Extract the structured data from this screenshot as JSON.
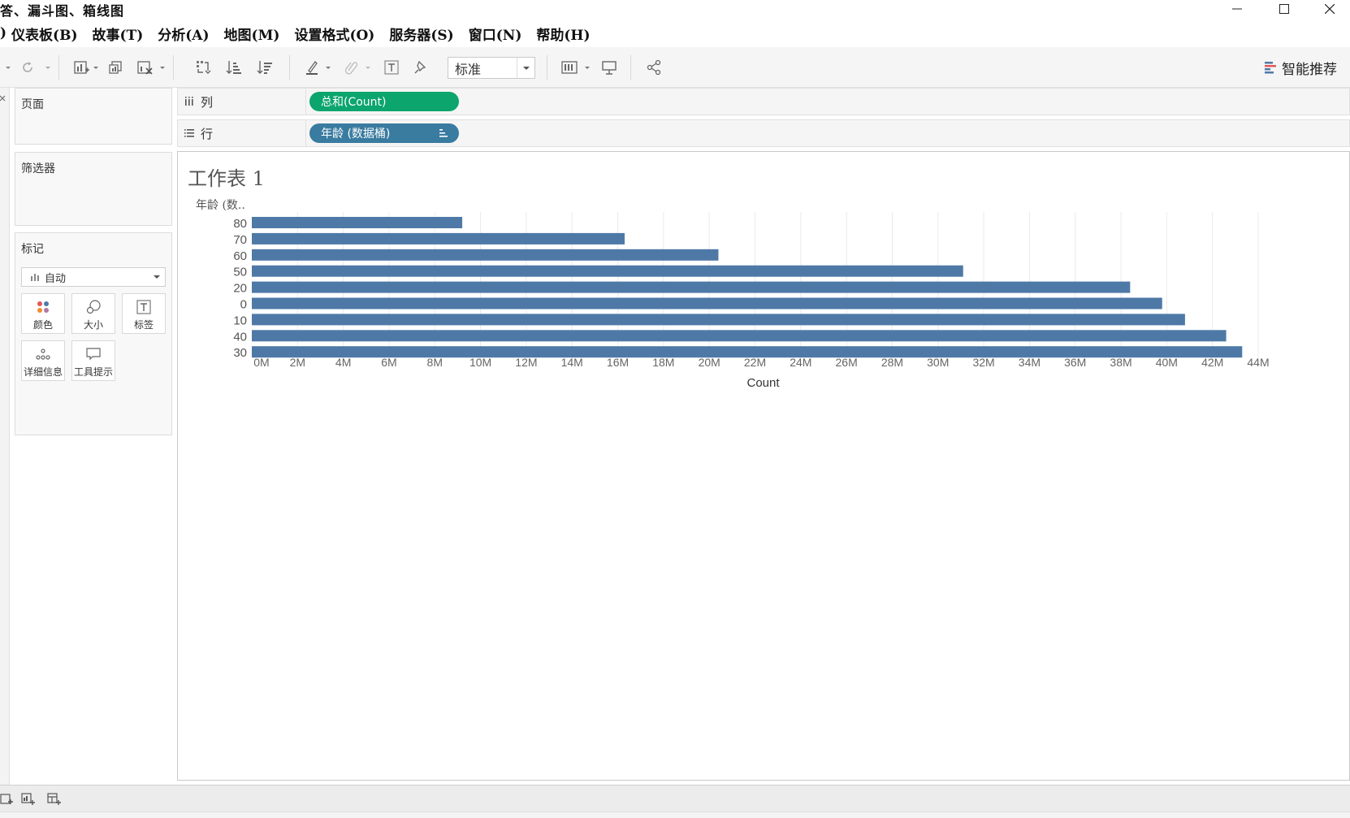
{
  "window": {
    "title": "答、漏斗图、箱线图",
    "controls": [
      "minimize-icon",
      "maximize-icon",
      "close-icon"
    ]
  },
  "menu": [
    ")",
    "仪表板(B)",
    "故事(T)",
    "分析(A)",
    "地图(M)",
    "设置格式(O)",
    "服务器(S)",
    "窗口(N)",
    "帮助(H)"
  ],
  "toolbar": {
    "fit_value": "标准",
    "smart_label": "智能推荐"
  },
  "left_panel": {
    "pages_title": "页面",
    "filters_title": "筛选器",
    "marks_title": "标记",
    "marks_type": "自动",
    "mark_buttons": {
      "color": "颜色",
      "size": "大小",
      "label": "标签",
      "detail": "详细信息",
      "tooltip": "工具提示"
    }
  },
  "shelves": {
    "columns_label": "列",
    "columns_pill": "总和(Count)",
    "rows_label": "行",
    "rows_pill": "年龄 (数据桶)"
  },
  "sheet": {
    "title": "工作表 1"
  },
  "colors": {
    "bar": "#4e79a7",
    "pill_measure": "#0ba56d",
    "pill_dimension": "#3a7ba0",
    "gridline": "#ebebeb"
  },
  "chart_data": {
    "type": "bar",
    "orientation": "horizontal",
    "title": "",
    "ylabel": "年龄 (数..",
    "xlabel": "Count",
    "categories": [
      "80",
      "70",
      "60",
      "50",
      "20",
      "0",
      "10",
      "40",
      "30"
    ],
    "values": [
      9200000,
      16300000,
      20400000,
      31100000,
      38400000,
      39800000,
      40800000,
      42600000,
      43300000
    ],
    "xlim": [
      0,
      44000000
    ],
    "x_ticks": [
      0,
      2000000,
      4000000,
      6000000,
      8000000,
      10000000,
      12000000,
      14000000,
      16000000,
      18000000,
      20000000,
      22000000,
      24000000,
      26000000,
      28000000,
      30000000,
      32000000,
      34000000,
      36000000,
      38000000,
      40000000,
      42000000,
      44000000
    ],
    "x_tick_labels": [
      "0M",
      "2M",
      "4M",
      "6M",
      "8M",
      "10M",
      "12M",
      "14M",
      "16M",
      "18M",
      "20M",
      "22M",
      "24M",
      "26M",
      "28M",
      "30M",
      "32M",
      "34M",
      "36M",
      "38M",
      "40M",
      "42M",
      "44M"
    ],
    "grid": true,
    "legend": "none"
  }
}
